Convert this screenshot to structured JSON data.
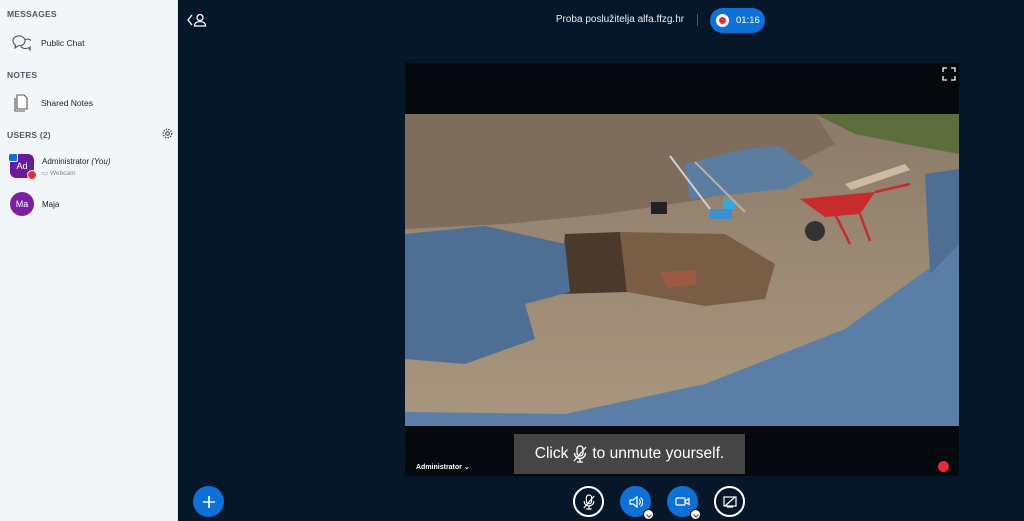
{
  "sidebar": {
    "messages_heading": "MESSAGES",
    "public_chat": "Public Chat",
    "notes_heading": "NOTES",
    "shared_notes": "Shared Notes",
    "users_heading": "USERS (2)",
    "users": [
      {
        "initials": "Ad",
        "name": "Administrator",
        "you": "(You)",
        "status": "Webcam",
        "color": "#6a1b9a",
        "shape": "square"
      },
      {
        "initials": "Ma",
        "name": "Maja",
        "color": "#7b1fa2",
        "shape": "round"
      }
    ]
  },
  "header": {
    "title": "Proba poslužitelja alfa.ffzg.hr",
    "recording_time": "01:16"
  },
  "webcam": {
    "user_label": "Administrator"
  },
  "toast": {
    "before": "Click",
    "after": "to unmute yourself."
  },
  "colors": {
    "primary": "#0f70d7",
    "background": "#06172a",
    "danger": "#e22d3b",
    "sidebar_bg": "#f3f6f9"
  },
  "icons": [
    "chat-icon",
    "notes-icon",
    "gear-icon",
    "user-back-icon",
    "fullscreen-icon",
    "plus-icon",
    "mic-muted-icon",
    "speaker-icon",
    "video-icon",
    "screenshare-off-icon"
  ]
}
